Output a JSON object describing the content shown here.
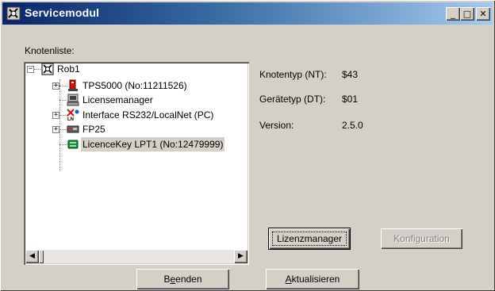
{
  "window": {
    "title": "Servicemodul",
    "controls": {
      "minimize": "_",
      "maximize": "□",
      "close": "✕"
    }
  },
  "tree": {
    "label": "Knotenliste:",
    "root": {
      "label": "Rob1",
      "expander": "−"
    },
    "items": [
      {
        "label": "TPS5000 (No:11211526)",
        "icon": "power-source-icon",
        "expander": "+"
      },
      {
        "label": "Licensemanager",
        "icon": "computer-icon",
        "expander": ""
      },
      {
        "label": "Interface RS232/LocalNet (PC)",
        "icon": "network-interface-icon",
        "expander": "+"
      },
      {
        "label": "FP25",
        "icon": "wire-feeder-icon",
        "expander": "+"
      },
      {
        "label": "LicenceKey LPT1 (No:12479999)",
        "icon": "licence-key-icon",
        "expander": "",
        "selected": true
      }
    ]
  },
  "details": [
    {
      "label": "Knotentyp (NT):",
      "value": "$43"
    },
    {
      "label": "Gerätetyp (DT):",
      "value": "$01"
    },
    {
      "label": "Version:",
      "value": "2.5.0"
    }
  ],
  "buttons": {
    "lizenzmanager": "Lizenzmanager",
    "konfiguration": "Konfiguration",
    "beenden_pre": "B",
    "beenden_mn": "e",
    "beenden_post": "enden",
    "aktualisieren_mn": "A",
    "aktualisieren_post": "ktualisieren"
  },
  "scrollbar": {
    "left": "◀",
    "right": "▶"
  }
}
